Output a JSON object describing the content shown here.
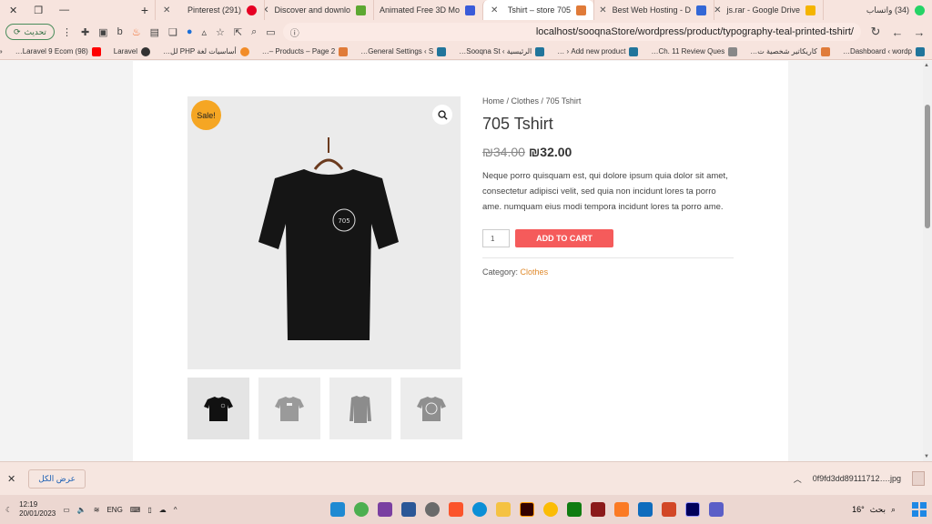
{
  "browser": {
    "tabs": [
      {
        "label": "(34) واتساب",
        "color": "#25d366",
        "active": false
      },
      {
        "label": "js.rar - Google Drive",
        "color": "#f4b400",
        "active": false
      },
      {
        "label": "Best Web Hosting - D",
        "color": "#3367d6",
        "active": false
      },
      {
        "label": "705 Tshirt – store",
        "color": "#e07b39",
        "active": true
      },
      {
        "label": "Animated Free 3D Mo",
        "color": "#3a5bd9",
        "active": false
      },
      {
        "label": "Discover and downlo",
        "color": "#5da832",
        "active": false
      },
      {
        "label": "(291) Pinterest",
        "color": "#e60023",
        "active": false
      }
    ],
    "url": "localhost/sooqnaStore/wordpress/product/typography-teal-printed-tshirt/",
    "refresh_label": "تحديث",
    "bookmarks": [
      {
        "label": "Dashboard ‹ wordp…",
        "color": "#21759b"
      },
      {
        "label": "كاريكاتير شخصية ت…",
        "color": "#e07b39"
      },
      {
        "label": "Ch. 11 Review Ques…",
        "color": "#888888"
      },
      {
        "label": "Add new product ‹ …",
        "color": "#21759b"
      },
      {
        "label": "الرئيسية › Sooqna St…",
        "color": "#21759b"
      },
      {
        "label": "General Settings ‹ S…",
        "color": "#21759b"
      },
      {
        "label": "Products – Page 2 –…",
        "color": "#e07b39"
      },
      {
        "label": "أساسيات لغة PHP لل…",
        "color": "#f28c28"
      },
      {
        "label": "Laravel",
        "color": "#333333"
      },
      {
        "label": "(98) Laravel 9 Ecom…",
        "color": "#ff0000"
      }
    ]
  },
  "product": {
    "breadcrumb": [
      "Home",
      "Clothes",
      "705 Tshirt"
    ],
    "title": "705 Tshirt",
    "price_old": "₪34.00",
    "price_new": "₪32.00",
    "description": "Neque porro quisquam est, qui dolore ipsum quia dolor sit amet, consectetur adipisci velit, sed quia non incidunt lores ta porro ame. numquam eius modi tempora incidunt lores ta porro ame.",
    "sale_badge": "Sale!",
    "quantity": "1",
    "add_to_cart": "ADD TO CART",
    "category_label": "Category:",
    "category_value": "Clothes",
    "print_text": "705",
    "thumbnails": [
      {
        "shirt_color": "#111111",
        "active": true
      },
      {
        "shirt_color": "#9a9a9a",
        "active": false
      },
      {
        "shirt_color": "#8c8c8c",
        "active": false
      },
      {
        "shirt_color": "#8f8f8f",
        "active": false
      }
    ]
  },
  "downloads": {
    "show_all": "عرض الكل",
    "file": "0f9fd3dd89111712….jpg"
  },
  "taskbar": {
    "time": "12:19",
    "date": "20/01/2023",
    "lang": "ENG",
    "search": "بحث",
    "weather": "16°"
  }
}
